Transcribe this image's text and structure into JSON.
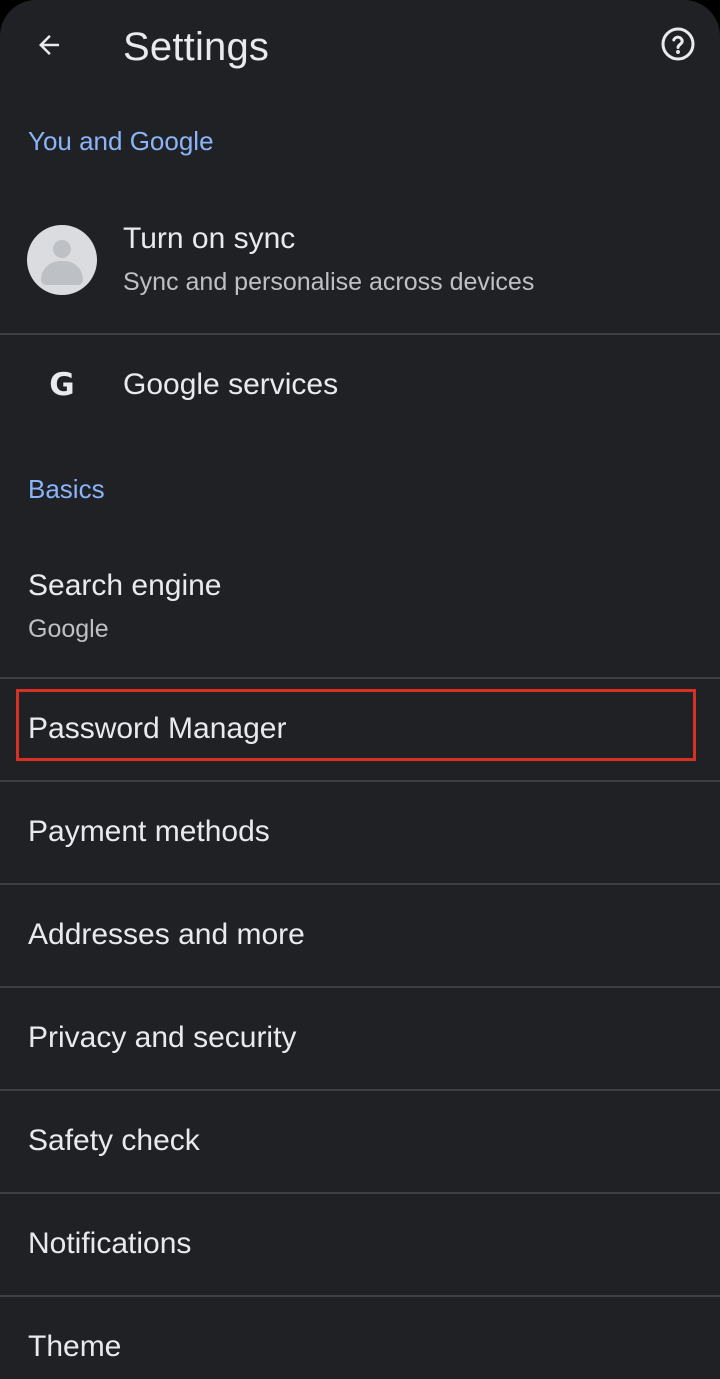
{
  "header": {
    "title": "Settings",
    "back_icon": "arrow-back-icon",
    "help_icon": "help-circle-icon"
  },
  "sections": {
    "you_and_google": "You and Google",
    "basics": "Basics"
  },
  "sync": {
    "title": "Turn on sync",
    "subtitle": "Sync and personalise across devices",
    "avatar_icon": "account-avatar-icon"
  },
  "google_services": {
    "title": "Google services",
    "icon": "google-g-icon",
    "icon_glyph": "G"
  },
  "search_engine": {
    "title": "Search engine",
    "value": "Google"
  },
  "items": {
    "password_manager": "Password Manager",
    "payment_methods": "Payment methods",
    "addresses": "Addresses and more",
    "privacy": "Privacy and security",
    "safety_check": "Safety check",
    "notifications": "Notifications",
    "theme": "Theme"
  },
  "colors": {
    "background": "#202124",
    "text_primary": "#e8eaed",
    "text_secondary": "#bdc1c6",
    "accent": "#8ab4f8",
    "divider": "#3c4043",
    "highlight": "#d93025"
  }
}
